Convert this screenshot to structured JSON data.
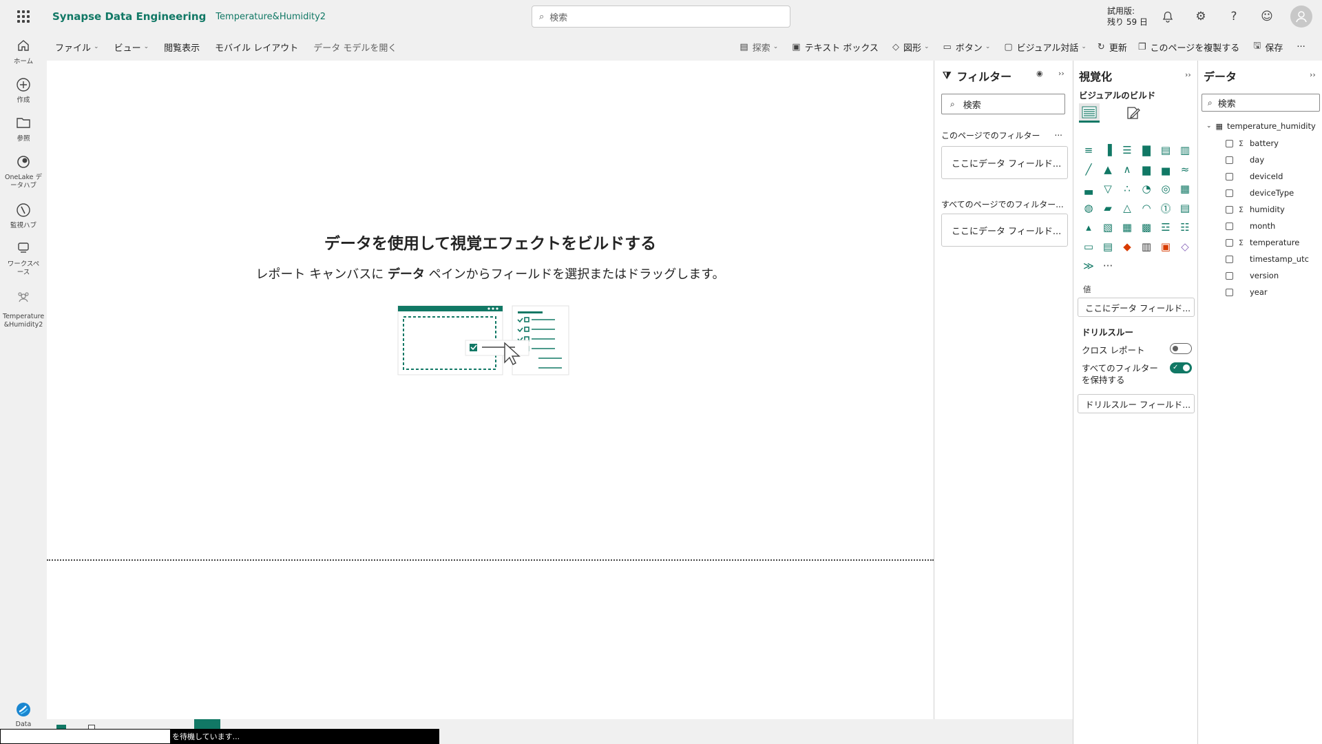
{
  "header": {
    "app_name": "Synapse Data Engineering",
    "report_name": "Temperature&Humidity2",
    "search_placeholder": "検索",
    "trial_line1": "試用版:",
    "trial_line2": "残り 59 日"
  },
  "leftrail": {
    "items": [
      {
        "label": "ホーム",
        "icon": "home-icon"
      },
      {
        "label": "作成",
        "icon": "create-icon"
      },
      {
        "label": "参照",
        "icon": "browse-icon"
      },
      {
        "label": "OneLake データハブ",
        "icon": "onelake-icon"
      },
      {
        "label": "監視ハブ",
        "icon": "monitor-icon"
      },
      {
        "label": "ワークスペース",
        "icon": "workspace-icon"
      },
      {
        "label": "Temperature &Humidity2",
        "icon": "report-icon"
      }
    ],
    "bottom_label": "Data"
  },
  "ribbon": {
    "file": "ファイル",
    "view": "ビュー",
    "reading_view": "閲覧表示",
    "mobile_layout": "モバイル レイアウト",
    "open_data_model": "データ モデルを開く",
    "explore": "探索",
    "text_box": "テキスト ボックス",
    "shapes": "図形",
    "buttons": "ボタン",
    "visual_interactions": "ビジュアル対話",
    "refresh": "更新",
    "duplicate_page": "このページを複製する",
    "save": "保存",
    "more": "···"
  },
  "canvas": {
    "title": "データを使用して視覚エフェクトをビルドする",
    "subtitle_pre": "レポート キャンバスに ",
    "subtitle_bold": "データ",
    "subtitle_post": " ペインからフィールドを選択またはドラッグします。"
  },
  "filters": {
    "title": "フィルター",
    "search_placeholder": "検索",
    "this_page": "このページでのフィルター",
    "this_page_more": "...",
    "this_page_well": "ここにデータ フィールド...",
    "all_pages": "すべてのページでのフィルター...",
    "all_pages_well": "ここにデータ フィールド..."
  },
  "viz": {
    "title": "視覚化",
    "build_label": "ビジュアルのビルド",
    "values_label": "値",
    "values_well": "ここにデータ フィールド...",
    "drillthrough_label": "ドリルスルー",
    "cross_report": "クロス レポート",
    "cross_report_on": false,
    "keep_filters_line1": "すべてのフィルター",
    "keep_filters_line2": "を保持する",
    "keep_filters_on": true,
    "drill_well": "ドリルスルー フィールド...",
    "more_visuals": "···"
  },
  "data": {
    "title": "データ",
    "search_placeholder": "検索",
    "table": "temperature_humidity",
    "fields": [
      {
        "name": "battery",
        "sigma": true
      },
      {
        "name": "day",
        "sigma": false
      },
      {
        "name": "deviceId",
        "sigma": false
      },
      {
        "name": "deviceType",
        "sigma": false
      },
      {
        "name": "humidity",
        "sigma": true
      },
      {
        "name": "month",
        "sigma": false
      },
      {
        "name": "temperature",
        "sigma": true
      },
      {
        "name": "timestamp_utc",
        "sigma": false
      },
      {
        "name": "version",
        "sigma": false
      },
      {
        "name": "year",
        "sigma": false
      }
    ]
  },
  "status": {
    "text": "を待機しています..."
  },
  "colors": {
    "accent": "#117865",
    "canvas": "#ffffff",
    "chrome": "#f0f0f0"
  }
}
